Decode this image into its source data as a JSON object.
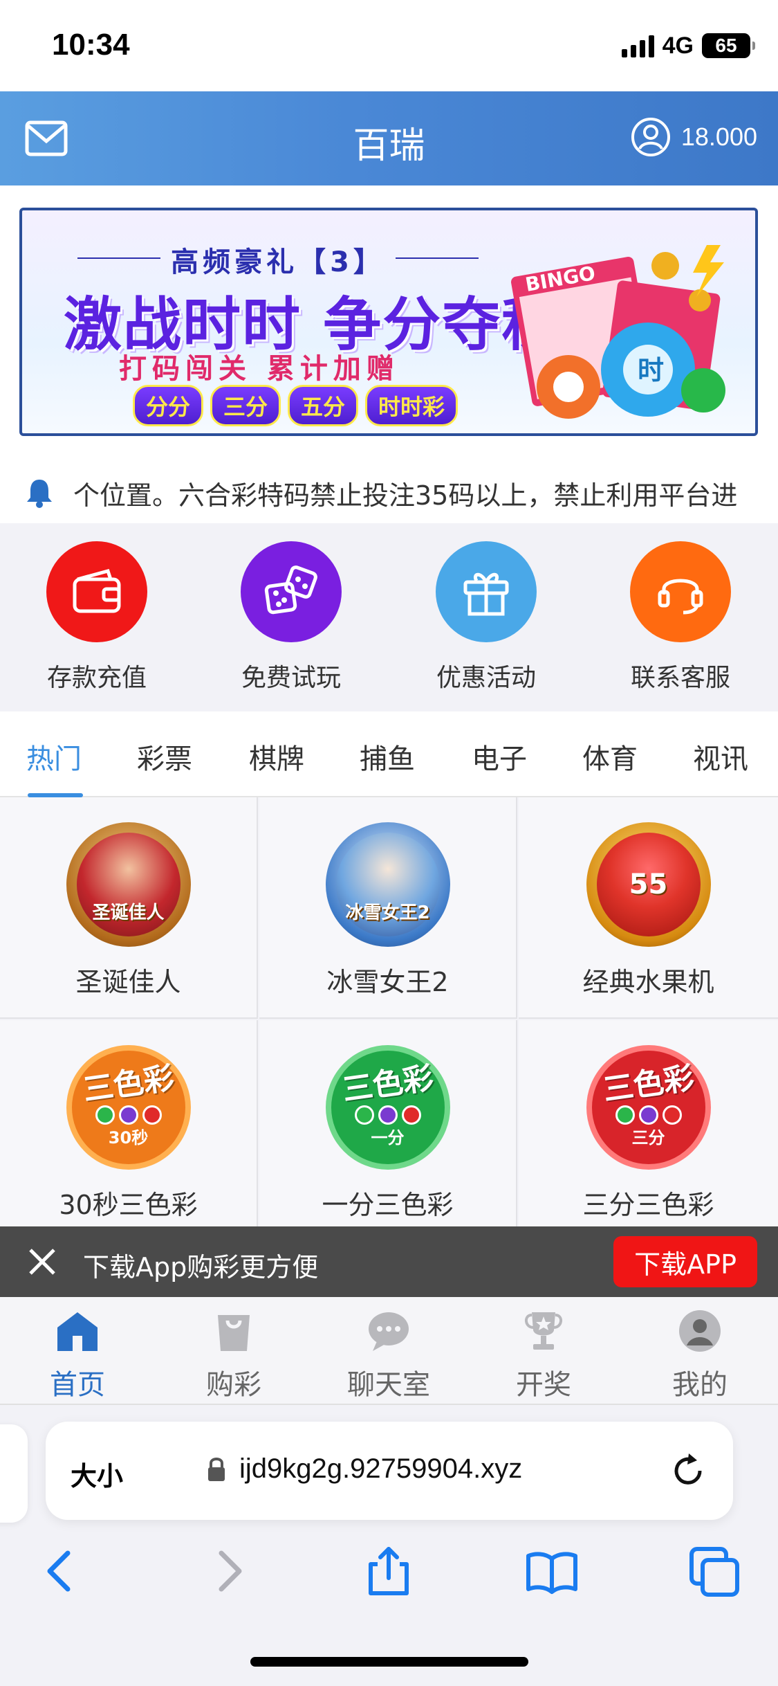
{
  "status_bar": {
    "time": "10:34",
    "network": "4G",
    "battery": "65"
  },
  "header": {
    "title": "百瑞",
    "balance": "18.000"
  },
  "banner": {
    "top_text": "高频豪礼【3】",
    "main_text": "激战时时 争分夺秒",
    "sub_text": "打码闯关 累计加赠",
    "tags": [
      "分分",
      "三分",
      "五分",
      "时时彩"
    ],
    "bingo_label": "BINGO",
    "ball_label": "时"
  },
  "notice": {
    "text": "个位置。六合彩特码禁止投注35码以上，禁止利用平台进"
  },
  "quick_actions": [
    {
      "label": "存款充值",
      "icon": "wallet-icon",
      "color": "#f01818"
    },
    {
      "label": "免费试玩",
      "icon": "dice-icon",
      "color": "#7a1fe0"
    },
    {
      "label": "优惠活动",
      "icon": "gift-icon",
      "color": "#4aa8e8"
    },
    {
      "label": "联系客服",
      "icon": "headset-icon",
      "color": "#ff6a10"
    }
  ],
  "tabs": [
    "热门",
    "彩票",
    "棋牌",
    "捕鱼",
    "电子",
    "体育",
    "视讯"
  ],
  "games": [
    {
      "label": "圣诞佳人",
      "badge": "圣诞佳人"
    },
    {
      "label": "冰雪女王2",
      "badge": "冰雪女王2"
    },
    {
      "label": "经典水果机",
      "badge": "55"
    },
    {
      "label": "30秒三色彩",
      "title": "三色彩",
      "sub": "30秒"
    },
    {
      "label": "一分三色彩",
      "title": "三色彩",
      "sub": "一分"
    },
    {
      "label": "三分三色彩",
      "title": "三色彩",
      "sub": "三分"
    }
  ],
  "download_bar": {
    "text": "下载App购彩更方便",
    "button": "下载APP"
  },
  "bottom_nav": [
    {
      "label": "首页",
      "icon": "home-icon"
    },
    {
      "label": "购彩",
      "icon": "shopping-bag-icon"
    },
    {
      "label": "聊天室",
      "icon": "chat-icon"
    },
    {
      "label": "开奖",
      "icon": "trophy-icon"
    },
    {
      "label": "我的",
      "icon": "profile-icon"
    }
  ],
  "browser": {
    "size_label": "大小",
    "url": "ijd9kg2g.92759904.xyz"
  },
  "colors": {
    "accent": "#3a8ee0",
    "header_blue": "#4a88d6",
    "download_red": "#f01515"
  }
}
